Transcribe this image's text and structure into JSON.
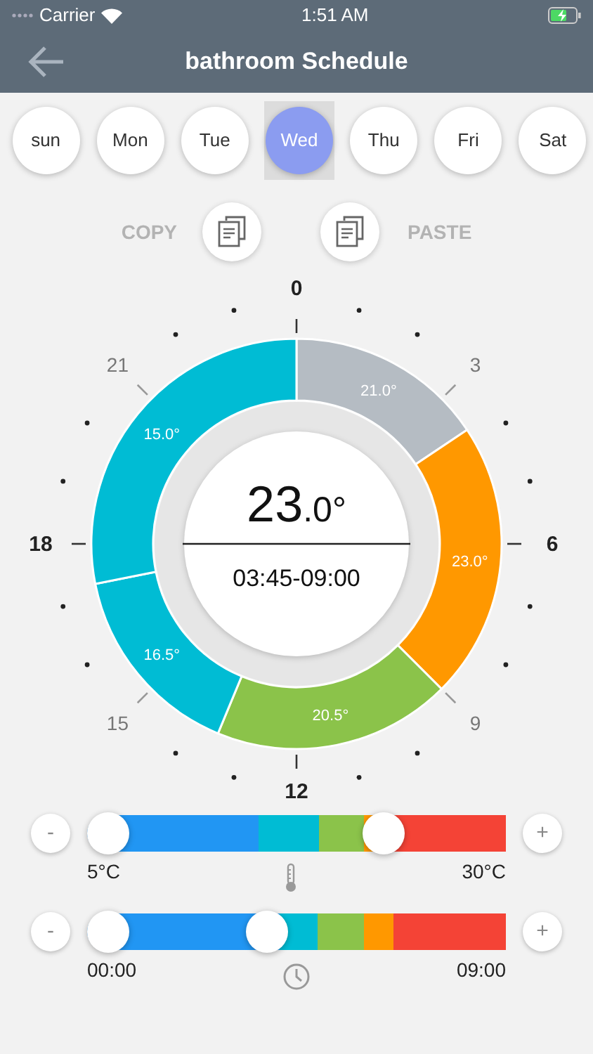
{
  "status_bar": {
    "carrier": "Carrier",
    "time": "1:51 AM"
  },
  "header": {
    "title": "bathroom Schedule"
  },
  "days": [
    {
      "label": "sun",
      "selected": false
    },
    {
      "label": "Mon",
      "selected": false
    },
    {
      "label": "Tue",
      "selected": false
    },
    {
      "label": "Wed",
      "selected": true
    },
    {
      "label": "Thu",
      "selected": false
    },
    {
      "label": "Fri",
      "selected": false
    },
    {
      "label": "Sat",
      "selected": false
    }
  ],
  "copy_label": "COPY",
  "paste_label": "PASTE",
  "dial": {
    "hours": [
      {
        "label": "0",
        "major": true
      },
      {
        "label": "3",
        "major": false
      },
      {
        "label": "6",
        "major": true
      },
      {
        "label": "9",
        "major": false
      },
      {
        "label": "12",
        "major": true
      },
      {
        "label": "15",
        "major": false
      },
      {
        "label": "18",
        "major": true
      },
      {
        "label": "21",
        "major": false
      }
    ],
    "segments": [
      {
        "label": "21.0°",
        "color": "#b5bcc3"
      },
      {
        "label": "23.0°",
        "color": "#ff9800"
      },
      {
        "label": "20.5°",
        "color": "#8bc34a"
      },
      {
        "label": "16.5°",
        "color": "#00bcd4"
      },
      {
        "label": "15.0°",
        "color": "#00bcd4"
      }
    ],
    "temp_whole": "23",
    "temp_fraction": ".0°",
    "time_range": "03:45-09:00"
  },
  "sliders": [
    {
      "kind": "temperature",
      "minus": "-",
      "plus": "+",
      "min_label": "5°C",
      "max_label": "30°C",
      "low": {
        "level": 0
      },
      "high": {
        "level": 0.73
      },
      "bands": [
        {
          "color": "#2196f3"
        },
        {
          "color": "#00bcd4"
        },
        {
          "color": "#8bc34a"
        },
        {
          "color": "#ff9800"
        },
        {
          "color": "#f44336"
        }
      ]
    },
    {
      "kind": "time",
      "minus": "-",
      "plus": "+",
      "min_label": "00:00",
      "max_label": "09:00",
      "low": {
        "level": 0
      },
      "high": {
        "level": 0.42
      },
      "bands": [
        {
          "color": "#2196f3"
        },
        {
          "color": "#00bcd4"
        },
        {
          "color": "#8bc34a"
        },
        {
          "color": "#ff9800"
        },
        {
          "color": "#f44336"
        }
      ]
    }
  ]
}
